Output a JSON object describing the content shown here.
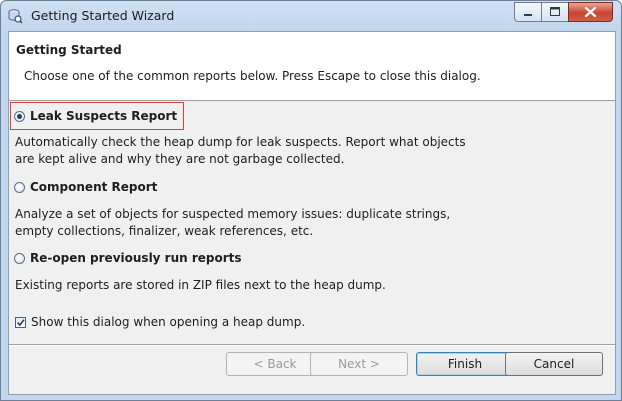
{
  "window": {
    "title": "Getting Started Wizard",
    "controls": {
      "minimize": "minimize",
      "maximize": "maximize",
      "close": "close"
    }
  },
  "header": {
    "title": "Getting Started",
    "description": "Choose one of the common reports below. Press Escape to close this dialog."
  },
  "options": [
    {
      "label": "Leak Suspects Report",
      "selected": true,
      "description_lines": [
        "Automatically check the heap dump for leak suspects. Report what objects",
        "are kept alive and why they are not garbage collected."
      ]
    },
    {
      "label": "Component Report",
      "selected": false,
      "description_lines": [
        "Analyze a set of objects for suspected memory issues: duplicate strings,",
        "empty collections, finalizer, weak references, etc."
      ]
    },
    {
      "label": "Re-open previously run reports",
      "selected": false,
      "description_lines": [
        "Existing reports are stored in ZIP files next to the heap dump."
      ]
    }
  ],
  "show_dialog": {
    "label": "Show this dialog when opening a heap dump.",
    "checked": true
  },
  "buttons": {
    "back": "< Back",
    "next": "Next >",
    "finish": "Finish",
    "cancel": "Cancel"
  },
  "colors": {
    "title_bar": "#c2d6ee",
    "close_button": "#c8442f",
    "focus_outline": "#d94040",
    "dialog_bg": "#f0f0f0"
  }
}
